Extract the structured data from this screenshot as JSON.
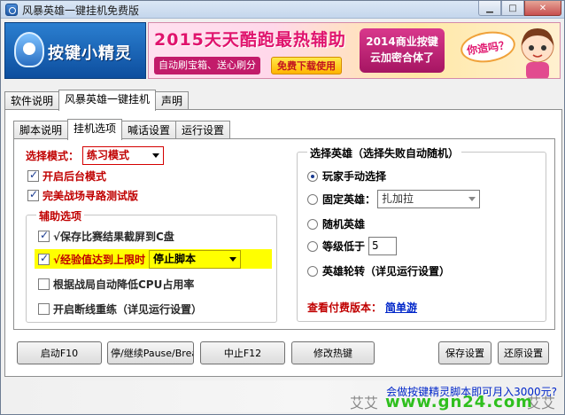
{
  "window": {
    "title": "风暴英雄一键挂机免费版"
  },
  "header": {
    "logo_text": "按键小精灵",
    "ad": {
      "title": "2015天天酷跑最热辅助",
      "sub": "自动刷宝箱、送心刷分",
      "download": "免费下载使用",
      "box2_line1": "2014商业按键",
      "box2_line2": "云加密合体了",
      "bubble": "你造吗？"
    }
  },
  "tabs_top": [
    "软件说明",
    "风暴英雄一键挂机",
    "声明"
  ],
  "tabs_inner": [
    "脚本说明",
    "挂机选项",
    "喊话设置",
    "运行设置"
  ],
  "left": {
    "mode_label": "选择模式：",
    "mode_value": "练习模式",
    "background_mode": "开启后台模式",
    "pathfinding_test": "完美战场寻路测试版",
    "aux_group_title": "辅助选项",
    "opt1": "√保存比赛结果截屏到C盘",
    "opt2": "√经验值达到上限时",
    "opt2_select": "停止脚本",
    "opt3": "根据战局自动降低CPU占用率",
    "opt4": "开启断线重练（详见运行设置）"
  },
  "right": {
    "group_title": "选择英雄（选择失败自动随机）",
    "r1": "玩家手动选择",
    "r2": "固定英雄：",
    "r2_select": "扎加拉",
    "r3": "随机英雄",
    "r4": "等级低于",
    "r4_value": "5",
    "r5": "英雄轮转（详见运行设置）",
    "paid_label": "查看付费版本：",
    "paid_link": "简单游"
  },
  "buttons": {
    "start": "启动F10",
    "pause": "停/继续Pause/Break",
    "stop": "中止F12",
    "hotkey": "修改热键",
    "save": "保存设置",
    "restore": "还原设置"
  },
  "footer": {
    "link": "会做按键精灵脚本即可月入3000元?",
    "watermark_green": "www.gn24.com",
    "watermark_left": "艾艾",
    "watermark_right": "艾艾"
  },
  "colors": {
    "accent_red": "#c00000",
    "link_blue": "#0026c9",
    "highlight_yellow": "#ffff00"
  }
}
